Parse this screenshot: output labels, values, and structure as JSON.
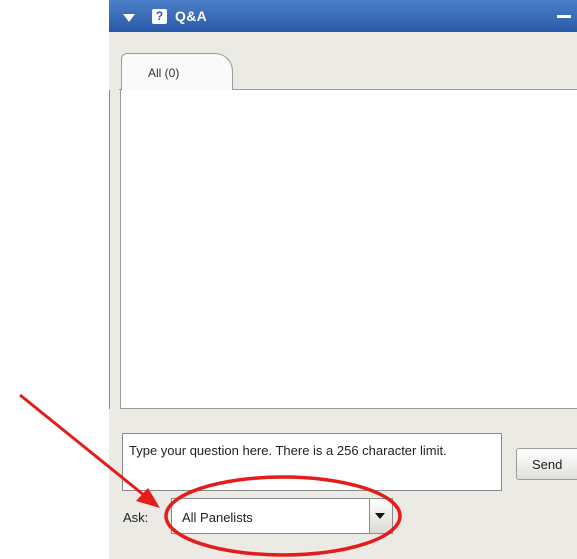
{
  "panel": {
    "title": "Q&A",
    "qa_icon_glyph": "?",
    "collapse_icon": "triangle-down",
    "minimize_icon": "minus"
  },
  "tabs": [
    {
      "label": "All (0)",
      "selected": true
    }
  ],
  "question_input": {
    "value": "Type your question here. There is a 256 character limit."
  },
  "send_button": {
    "label": "Send"
  },
  "ask": {
    "label": "Ask:",
    "selected": "All Panelists"
  },
  "colors": {
    "title_bar": "#2a5aa8",
    "annotation": "#e41c1c"
  }
}
